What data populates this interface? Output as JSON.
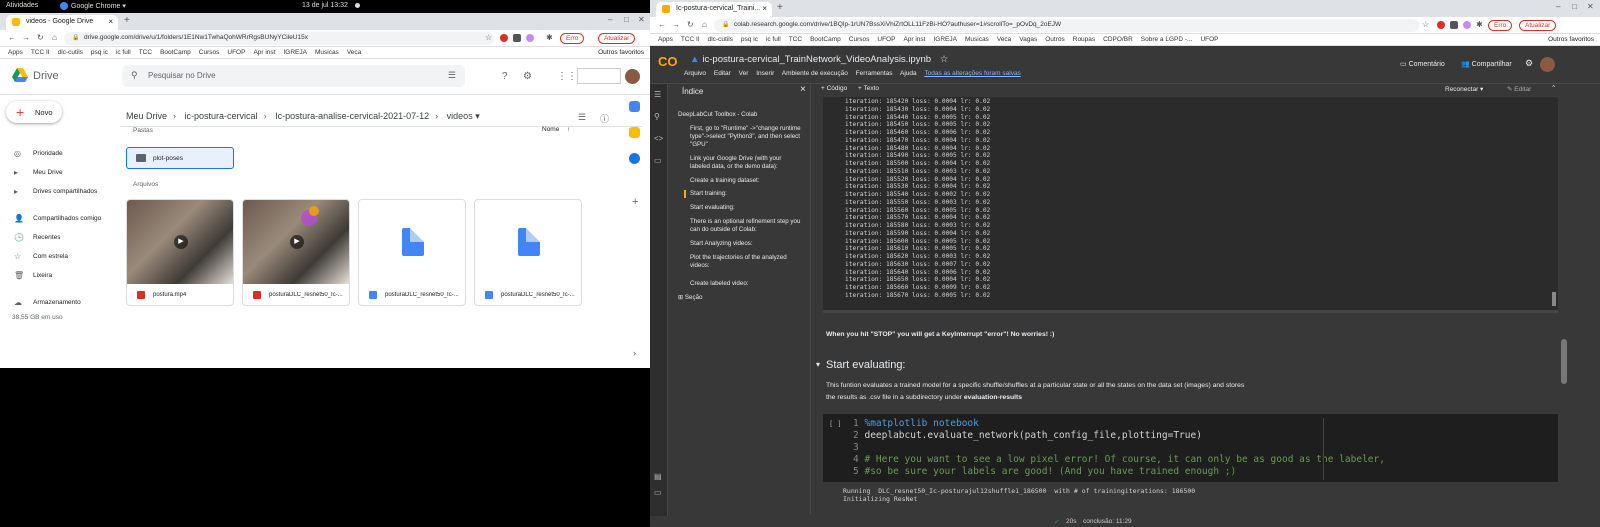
{
  "topbar": {
    "activities": "Atividades",
    "app": "Google Chrome ▾",
    "clock": "13 de jul  13:32"
  },
  "left": {
    "tab_title": "videos - Google Drive",
    "url": "drive.google.com/drive/u/1/folders/1E1Nw1TwhaQohWRrRgsBUNyYCileU15x",
    "error_label": "Erro",
    "update_label": "Atualizar",
    "bookmarks": [
      "Apps",
      "TCC II",
      "dlc-cutils",
      "psq ic",
      "ic full",
      "TCC",
      "BootCamp",
      "Cursos",
      "UFOP",
      "Apr inst",
      "IGREJA",
      "Musicas",
      "Veca"
    ],
    "bookmarks_other": "Outros favoritos",
    "drive_title": "Drive",
    "search_placeholder": "Pesquisar no Drive",
    "new_label": "Novo",
    "sidebar": [
      "Prioridade",
      "Meu Drive",
      "Drives compartilhados",
      "Compartilhados comigo",
      "Recentes",
      "Com estrela",
      "Lixeira",
      "Armazenamento"
    ],
    "storage_text": "38,55 GB em uso",
    "breadcrumb": [
      "Meu Drive",
      "ic-postura-cervical",
      "Ic-postura-analise-cervical-2021-07-12",
      "videos ▾"
    ],
    "pastas_label": "Pastas",
    "sort_label": "Nome",
    "folder_name": "plot-poses",
    "arquivos_label": "Arquivos",
    "files": [
      "postura.mp4",
      "posturaDLC_resnet50_Ic-...",
      "posturaDLC_resnet50_Ic-...",
      "posturaDLC_resnet50_Ic-..."
    ]
  },
  "right": {
    "tab_title": "Ic-postura-cervical_Traini...",
    "url": "colab.research.google.com/drive/1BQIp-1rUN7BssXiVhiZrtOLL11FzBi-HO?authuser=1#scrollTo=_pOvDq_2oEJW",
    "error_label": "Erro",
    "update_label": "Atualizar",
    "bookmarks": [
      "Apps",
      "TCC II",
      "dlc-cutils",
      "psq ic",
      "ic full",
      "TCC",
      "BootCamp",
      "Cursos",
      "UFOP",
      "Apr inst",
      "IGREJA",
      "Musicas",
      "Veca",
      "Vagas",
      "Outros",
      "Roupas",
      "CDPO/BR",
      "Sobre a LGPD -...",
      "UFOP"
    ],
    "bookmarks_other": "Outros favoritos",
    "notebook_name": "ic-postura-cervical_TrainNetwork_VideoAnalysis.ipynb",
    "menu": [
      "Arquivo",
      "Editar",
      "Ver",
      "Inserir",
      "Ambiente de execução",
      "Ferramentas",
      "Ajuda"
    ],
    "saved_text": "Todas as alterações foram salvas",
    "comment_label": "Comentário",
    "share_label": "Compartilhar",
    "toc_title": "Índice",
    "toc_items": [
      "DeepLabCut Toolbox - Colab",
      "First, go to \"Runtime\" ->\"change runtime type\"->select \"Python3\", and then select \"GPU\"",
      "Link your Google Drive (with your labeled data, or the demo data):",
      "Create a training dataset:",
      "Start training:",
      "Start evaluating:",
      "There is an optional refinement step you can do outside of Colab:",
      "Start Analyzing videos:",
      "Plot the trajectories of the analyzed videos:",
      "Create labeled video:"
    ],
    "toc_section": "Seção",
    "add_code": "+ Código",
    "add_text": "+ Texto",
    "reconnect": "Reconectar",
    "edit": "Editar",
    "log_lines": [
      "iteration: 185420 loss: 0.0004 lr: 0.02",
      "iteration: 185430 loss: 0.0004 lr: 0.02",
      "iteration: 185440 loss: 0.0005 lr: 0.02",
      "iteration: 185450 loss: 0.0005 lr: 0.02",
      "iteration: 185460 loss: 0.0006 lr: 0.02",
      "iteration: 185470 loss: 0.0004 lr: 0.02",
      "iteration: 185480 loss: 0.0004 lr: 0.02",
      "iteration: 185490 loss: 0.0005 lr: 0.02",
      "iteration: 185500 loss: 0.0004 lr: 0.02",
      "iteration: 185510 loss: 0.0003 lr: 0.02",
      "iteration: 185520 loss: 0.0004 lr: 0.02",
      "iteration: 185530 loss: 0.0004 lr: 0.02",
      "iteration: 185540 loss: 0.0002 lr: 0.02",
      "iteration: 185550 loss: 0.0003 lr: 0.02",
      "iteration: 185560 loss: 0.0005 lr: 0.02",
      "iteration: 185570 loss: 0.0004 lr: 0.02",
      "iteration: 185580 loss: 0.0003 lr: 0.02",
      "iteration: 185590 loss: 0.0004 lr: 0.02",
      "iteration: 185600 loss: 0.0005 lr: 0.02",
      "iteration: 185610 loss: 0.0005 lr: 0.02",
      "iteration: 185620 loss: 0.0003 lr: 0.02",
      "iteration: 185630 loss: 0.0007 lr: 0.02",
      "iteration: 185640 loss: 0.0006 lr: 0.02",
      "iteration: 185650 loss: 0.0004 lr: 0.02",
      "iteration: 185660 loss: 0.0009 lr: 0.02",
      "iteration: 185670 loss: 0.0005 lr: 0.02"
    ],
    "stop_note": "When you hit \"STOP\" you will get a KeyInterrupt \"error\"! No worries! :)",
    "section_title": "Start evaluating:",
    "desc_line1": "This funtion evaluates a trained model for a specific shuffle/shuffles at a particular state or all the states on the data set (images) and stores",
    "desc_line2a": "the results as .csv file in a subdirectory under ",
    "desc_line2b": "evaluation-results",
    "run_marker": "[ ]",
    "code_lines": [
      {
        "n": "1",
        "text": "%matplotlib notebook"
      },
      {
        "n": "2",
        "text": "deeplabcut.evaluate_network(path_config_file,plotting=True)"
      },
      {
        "n": "3",
        "text": ""
      },
      {
        "n": "4",
        "text": "# Here you want to see a low pixel error! Of course, it can only be as good as the labeler,"
      },
      {
        "n": "5",
        "text": "#so be sure your labels are good! (And you have trained enough ;)"
      }
    ],
    "out_line1": "Running  DLC_resnet50_Ic-posturajul12shuffle1_186500  with # of trainingiterations: 186500",
    "out_line2": "Initializing ResNet",
    "status_time": "20s",
    "status_done": "conclusão: 11:29"
  }
}
